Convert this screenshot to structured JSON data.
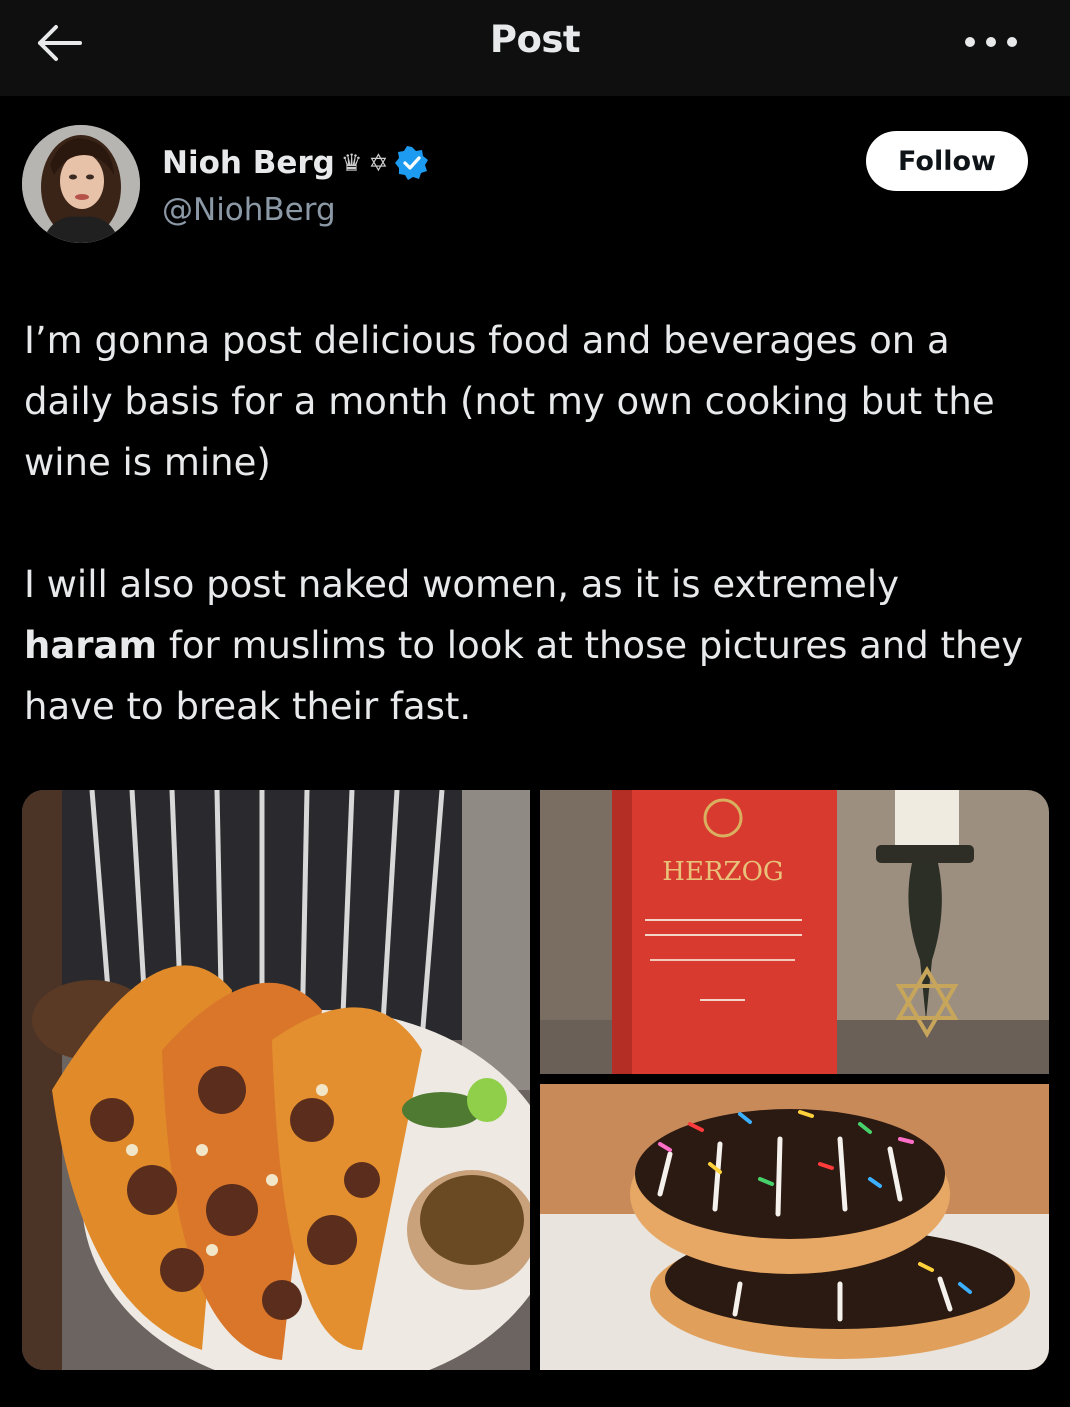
{
  "header": {
    "title": "Post",
    "back_icon": "arrow-left-icon",
    "more_icon": "more-horizontal-icon"
  },
  "author": {
    "name": "Nioh Berg",
    "crown_emoji": "♛",
    "star_emoji": "✡",
    "handle": "@NiohBerg",
    "verified": true,
    "verified_color": "#1d9bf0"
  },
  "follow_button": {
    "label": "Follow"
  },
  "post": {
    "paragraph1": "I’m gonna post delicious food and beverages on a daily basis for a month (not my own cooking but the wine is mine)",
    "paragraph2_before": "I will also post naked women, as it is extremely ",
    "paragraph2_bold": "haram",
    "paragraph2_after": " for muslims to look at those pictures and they have to break their fast."
  },
  "media": {
    "images": [
      "tacos-photo",
      "wine-bottle-candle-photo",
      "donuts-photo"
    ],
    "wine_label_brand": "HERZOG"
  }
}
